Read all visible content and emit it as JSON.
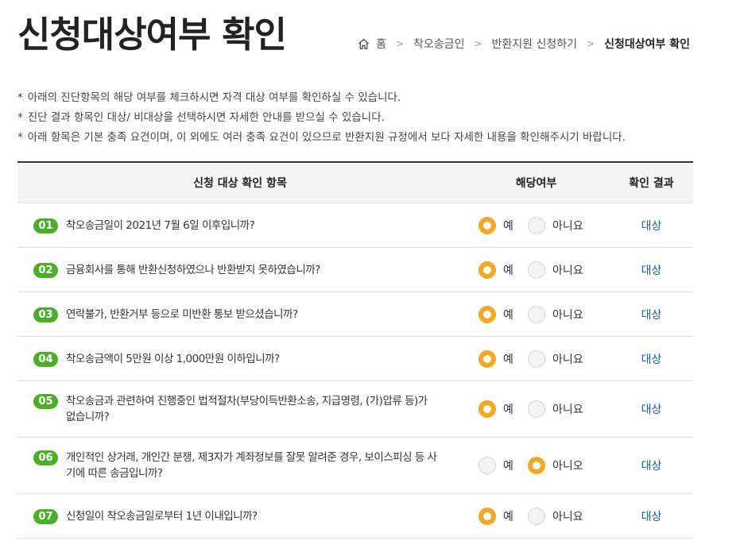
{
  "title": "신청대상여부 확인",
  "breadcrumb": {
    "home": "홈",
    "items": [
      "착오송금인",
      "반환지원 신청하기",
      "신청대상여부 확인"
    ]
  },
  "notes": [
    "아래의 진단항목의 해당 여부를 체크하시면 자격 대상 여부를 확인하실 수 있습니다.",
    "진단 결과 항목인 대상/ 비대상을 선택하시면 자세한 안내를 받으실 수 있습니다.",
    "아래 항목은 기본 충족 요건이며, 이 외에도 여러 충족 요건이 있으므로 반환지원 규정에서 보다 자세한 내용을 확인해주시기 바랍니다."
  ],
  "note_marker": "*",
  "table": {
    "headers": {
      "item": "신청 대상 확인 항목",
      "selection": "해당여부",
      "result": "확인 결과"
    },
    "rows": [
      {
        "num": "01",
        "text": "착오송금일이 2021년 7월 6일 이후입니까?",
        "yes_label": "예",
        "no_label": "아니요",
        "selected": "yes",
        "result": "대상"
      },
      {
        "num": "02",
        "text": "금융회사를 통해 반환신청하였으나 반환받지 못하였습니까?",
        "yes_label": "예",
        "no_label": "아니요",
        "selected": "yes",
        "result": "대상"
      },
      {
        "num": "03",
        "text": "연락불가, 반환거부 등으로 미반환 통보 받으셨습니까?",
        "yes_label": "예",
        "no_label": "아니요",
        "selected": "yes",
        "result": "대상"
      },
      {
        "num": "04",
        "text": "착오송금액이 5만원 이상 1,000만원 이하입니까?",
        "yes_label": "예",
        "no_label": "아니요",
        "selected": "yes",
        "result": "대상"
      },
      {
        "num": "05",
        "text": "착오송금과 관련하여 진행중인 법적절차(부당이득반환소송, 지급명령, (가)압류 등)가 없습니까?",
        "yes_label": "예",
        "no_label": "아니요",
        "selected": "yes",
        "result": "대상"
      },
      {
        "num": "06",
        "text": "개인적인 상거래, 개인간 분쟁, 제3자가 계좌정보를 잘못 알려준 경우, 보이스피싱 등 사기에 따른 송금입니까?",
        "yes_label": "예",
        "no_label": "아니오",
        "selected": "no",
        "result": "대상"
      },
      {
        "num": "07",
        "text": "신청일이 착오송금일로부터 1년 이내입니까?",
        "yes_label": "예",
        "no_label": "아니요",
        "selected": "yes",
        "result": "대상"
      }
    ]
  },
  "colors": {
    "badge": "#4caf2a",
    "radio_selected": "#f5a623",
    "result_link": "#1a5bb0"
  }
}
